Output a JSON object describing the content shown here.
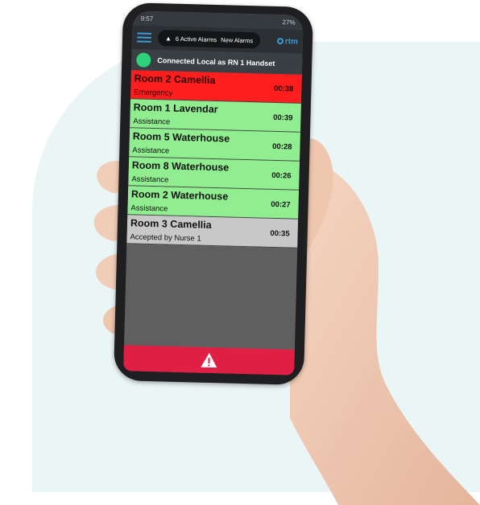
{
  "status_bar": {
    "time": "9:57",
    "battery": "27%"
  },
  "header": {
    "alarm_count_text": "6 Active Alarms",
    "new_alarms_label": "New Alarms",
    "logo_text": "rtm"
  },
  "connection": {
    "text": "Connected Local as RN 1 Handset",
    "indicator_color": "#2fd17a"
  },
  "alarms": [
    {
      "room": "Room 2 Camellia",
      "status": "Emergency",
      "time": "00:38",
      "state": "emergency"
    },
    {
      "room": "Room 1 Lavendar",
      "status": "Assistance",
      "time": "00:39",
      "state": "assistance"
    },
    {
      "room": "Room 5 Waterhouse",
      "status": "Assistance",
      "time": "00:28",
      "state": "assistance"
    },
    {
      "room": "Room 8 Waterhouse",
      "status": "Assistance",
      "time": "00:26",
      "state": "assistance"
    },
    {
      "room": "Room 2 Waterhouse",
      "status": "Assistance",
      "time": "00:27",
      "state": "assistance"
    },
    {
      "room": "Room 3 Camellia",
      "status": "Accepted by Nurse 1",
      "time": "00:35",
      "state": "accepted"
    }
  ],
  "colors": {
    "emergency": "#ff1e1e",
    "assistance": "#90ee90",
    "accepted": "#c8c8c8",
    "alert_bar": "#e01f45",
    "accent": "#3b9bd8"
  },
  "icons": {
    "menu": "hamburger-icon",
    "bell": "bell-icon",
    "alert": "warning-triangle-icon"
  }
}
